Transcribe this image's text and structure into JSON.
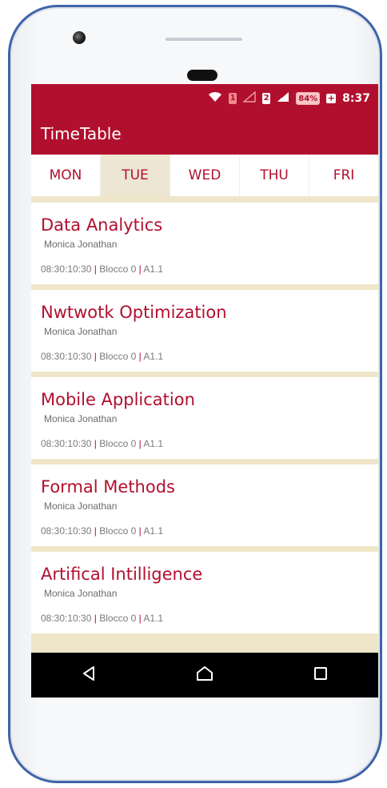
{
  "status_bar": {
    "sim1": "1",
    "sim2": "2",
    "battery": "84%",
    "battery_charge": "+",
    "time": "8:37"
  },
  "app_bar": {
    "title": "TimeTable"
  },
  "tabs": [
    {
      "label": "MON",
      "active": false
    },
    {
      "label": "TUE",
      "active": true
    },
    {
      "label": "WED",
      "active": false
    },
    {
      "label": "THU",
      "active": false
    },
    {
      "label": "FRI",
      "active": false
    }
  ],
  "lessons": [
    {
      "title": "Data Analytics",
      "teacher": "Monica Jonathan",
      "time": "08:30:10:30",
      "building": "Blocco 0",
      "room": "A1.1"
    },
    {
      "title": "Nwtwotk Optimization",
      "teacher": "Monica Jonathan",
      "time": "08:30:10:30",
      "building": "Blocco 0",
      "room": "A1.1"
    },
    {
      "title": "Mobile Application",
      "teacher": "Monica Jonathan",
      "time": "08:30:10:30",
      "building": "Blocco 0",
      "room": "A1.1"
    },
    {
      "title": "Formal Methods",
      "teacher": "Monica Jonathan",
      "time": "08:30:10:30",
      "building": "Blocco 0",
      "room": "A1.1"
    },
    {
      "title": "Artifical Intilligence",
      "teacher": "Monica Jonathan",
      "time": "08:30:10:30",
      "building": "Blocco 0",
      "room": "A1.1"
    }
  ],
  "separator": "|",
  "icons": {
    "wifi": "wifi-icon",
    "signal": "signal-icon",
    "back": "back-icon",
    "home": "home-icon",
    "recents": "recents-icon"
  },
  "colors": {
    "accent": "#b10f2e",
    "background": "#efe6c9",
    "active_tab": "#ece6d2"
  }
}
